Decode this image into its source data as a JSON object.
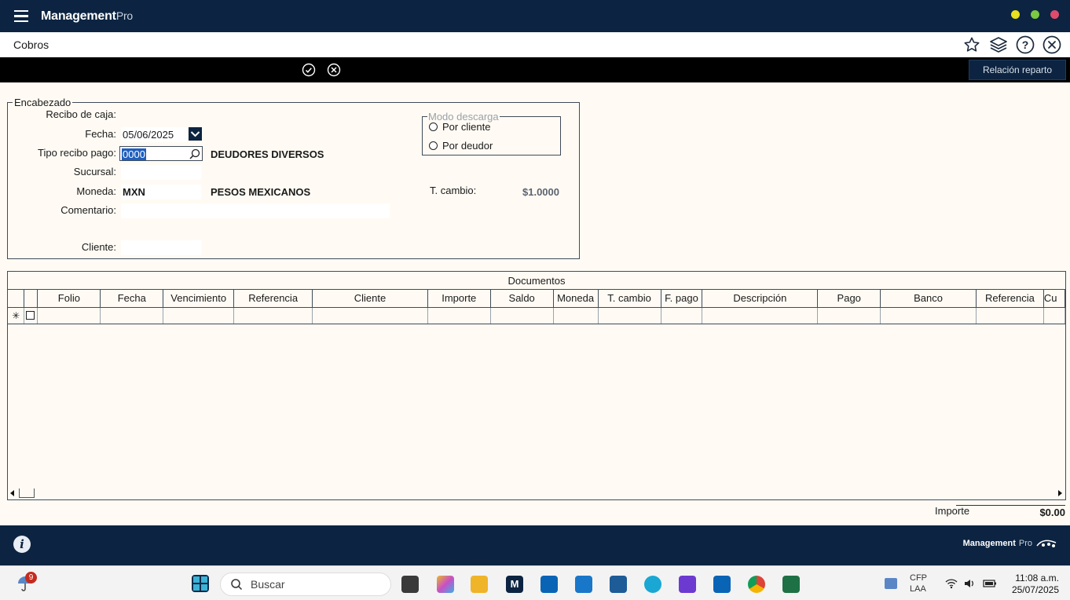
{
  "app": {
    "title_main": "Management",
    "title_pro": "Pro",
    "window_dot_colors": [
      "#e8e021",
      "#7ac943",
      "#e04b6b"
    ]
  },
  "page": {
    "title": "Cobros",
    "icons": [
      "star-icon",
      "layers-icon",
      "help-icon",
      "close-circle-icon"
    ]
  },
  "toolbar": {
    "icons": [
      "accept-icon",
      "cancel-icon"
    ],
    "relacion_button": "Relación reparto"
  },
  "encabezado": {
    "legend": "Encabezado",
    "recibo_label": "Recibo de caja:",
    "fecha_label": "Fecha:",
    "fecha_value": "05/06/2025",
    "tipo_label": "Tipo recibo pago:",
    "tipo_value": "0000",
    "tipo_desc": "DEUDORES DIVERSOS",
    "sucursal_label": "Sucursal:",
    "moneda_label": "Moneda:",
    "moneda_value": "MXN",
    "moneda_desc": "PESOS MEXICANOS",
    "comentario_label": "Comentario:",
    "cliente_label": "Cliente:",
    "tcambio_label": "T. cambio:",
    "tcambio_value": "$1.0000",
    "modo": {
      "legend": "Modo descarga",
      "option1": "Por cliente",
      "option2": "Por deudor"
    }
  },
  "documentos": {
    "title": "Documentos",
    "new_row_marker": "✳",
    "columns": [
      "Folio",
      "Fecha",
      "Vencimiento",
      "Referencia",
      "Cliente",
      "Importe",
      "Saldo",
      "Moneda",
      "T. cambio",
      "F. pago",
      "Descripción",
      "Pago",
      "Banco",
      "Referencia",
      "Cu"
    ]
  },
  "totals": {
    "importe_label": "Importe",
    "importe_value": "$0.00"
  },
  "footer": {
    "logo_main": "Management",
    "logo_pro": "Pro"
  },
  "taskbar": {
    "notification_count": "9",
    "search_placeholder": "Buscar",
    "tray_text_1": "CFP",
    "tray_text_2": "LAA",
    "time": "11:08 a.m.",
    "date": "25/07/2025"
  }
}
